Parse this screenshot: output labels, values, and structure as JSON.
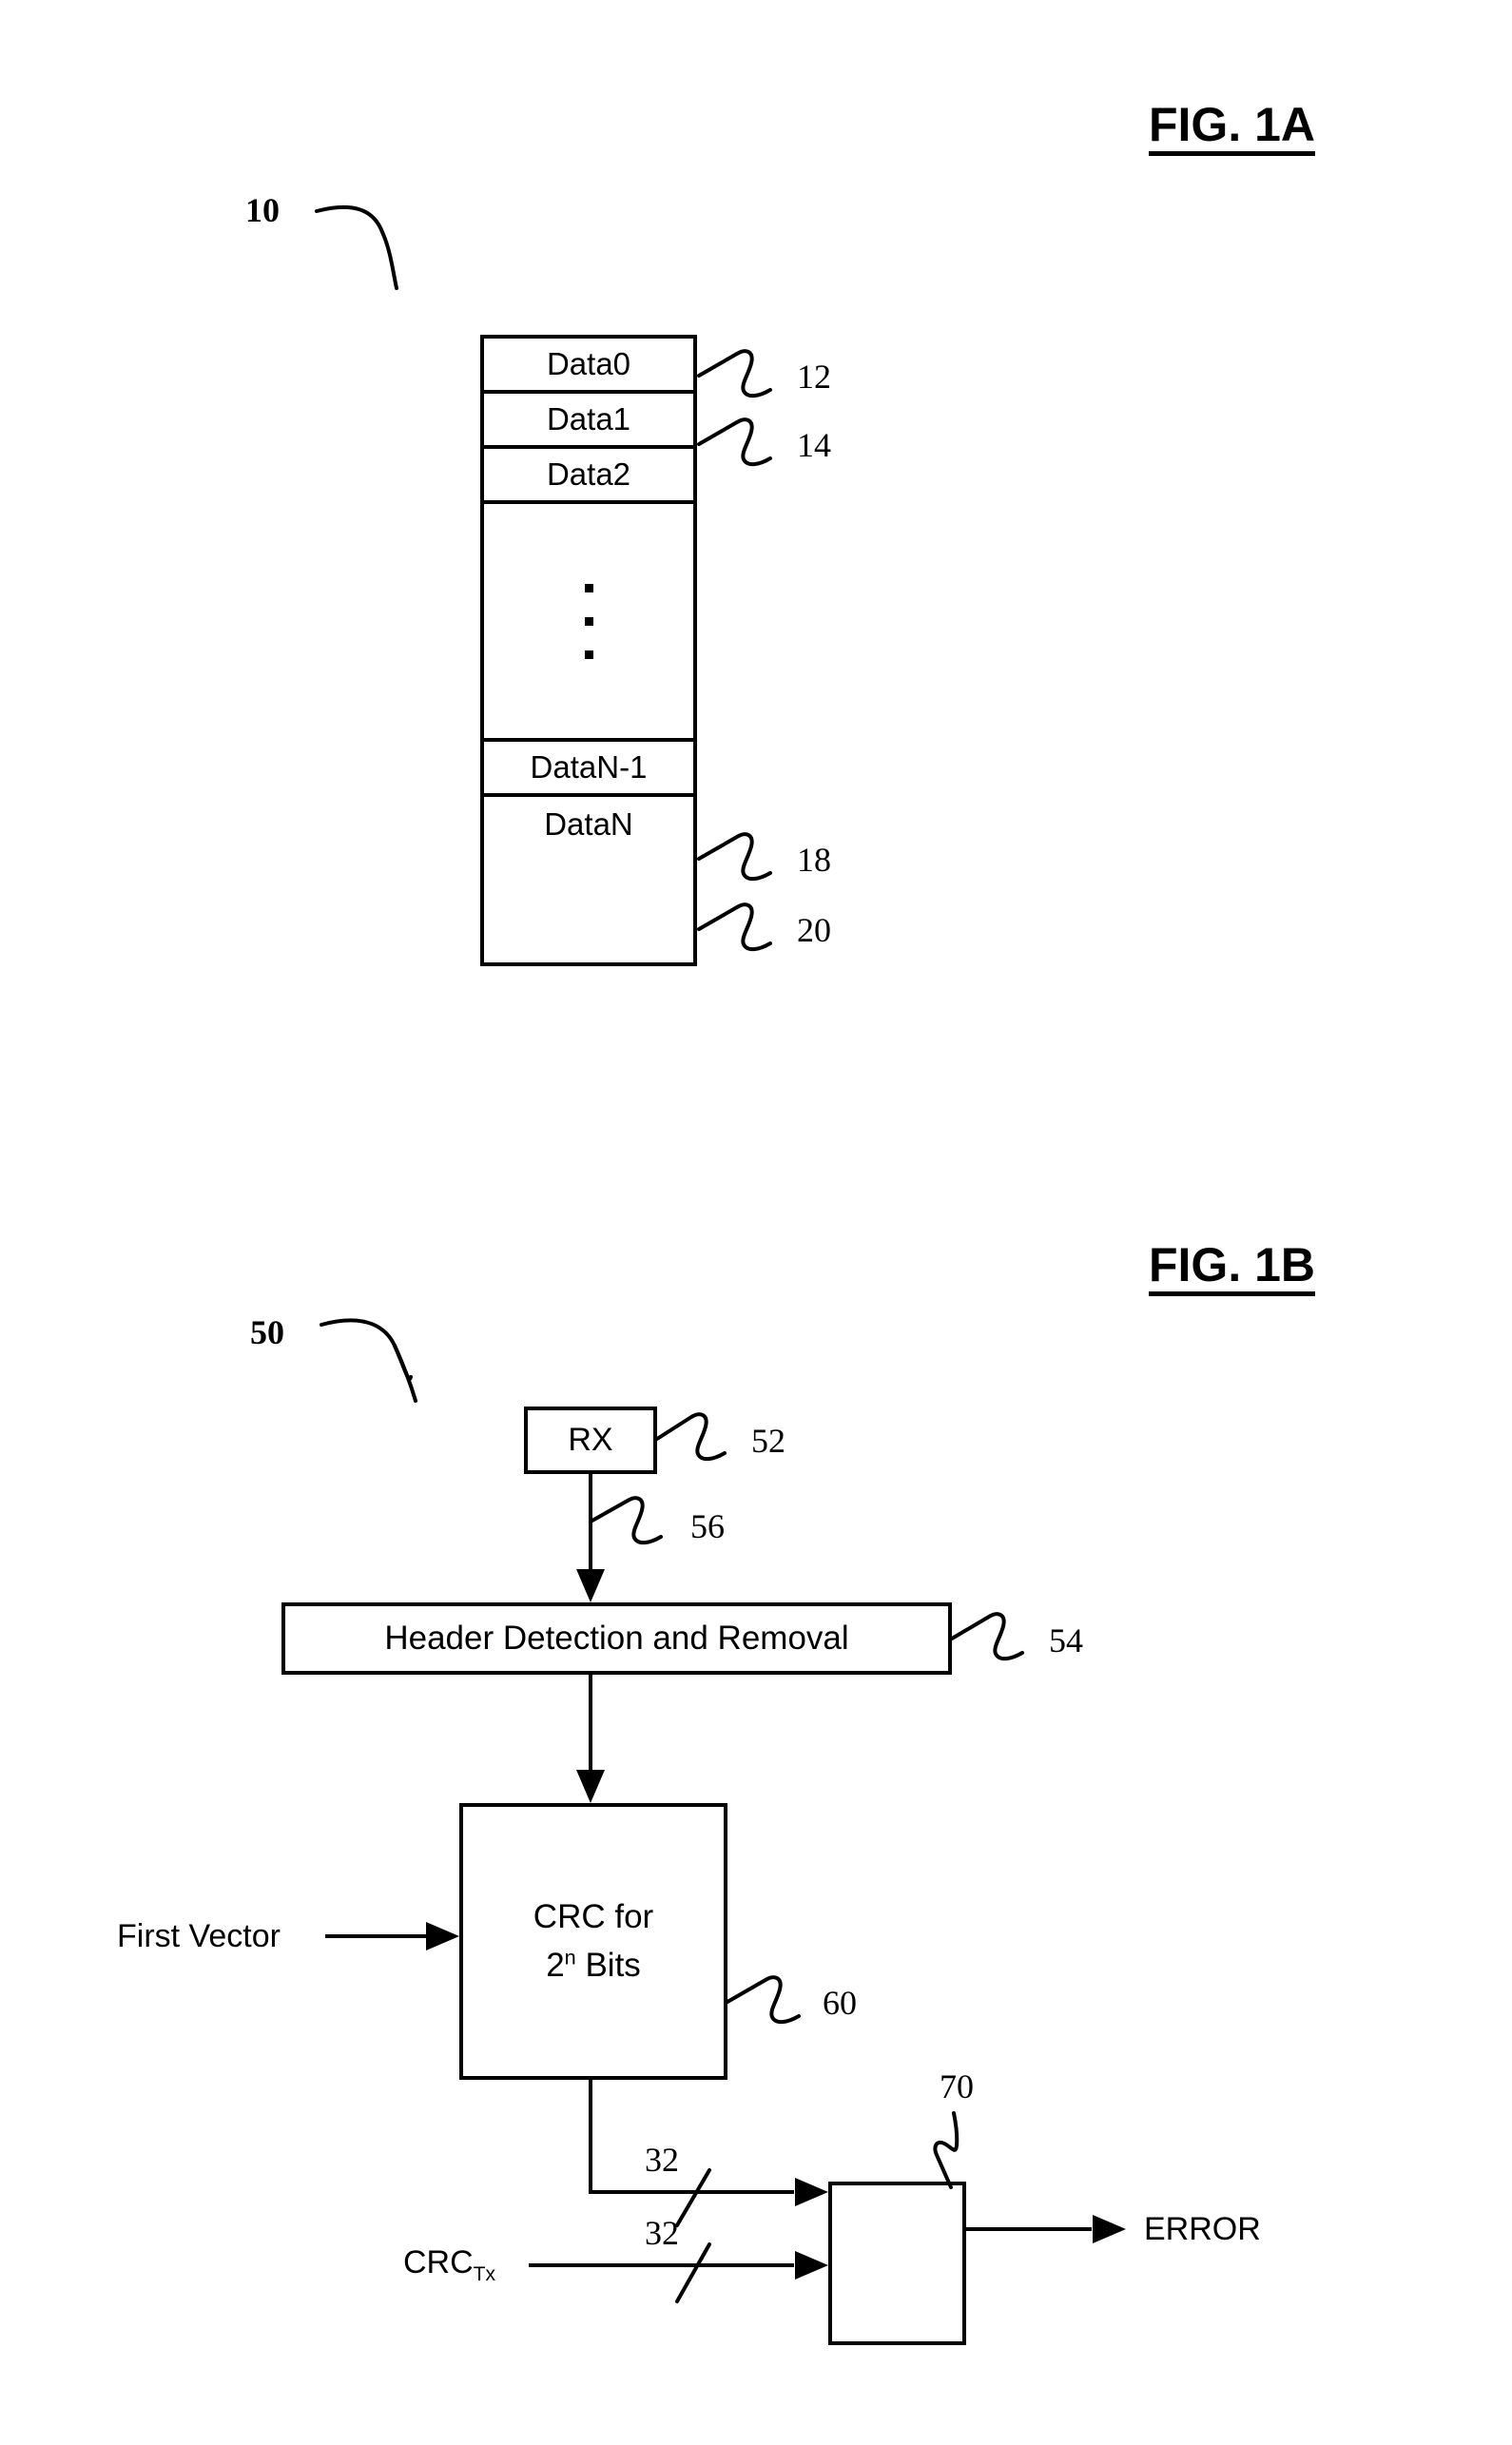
{
  "figures": [
    {
      "title": "FIG. 1A",
      "ref_label": "10",
      "data_block": {
        "cells": [
          {
            "label": "Data0",
            "ref": "12"
          },
          {
            "label": "Data1",
            "ref": "14"
          },
          {
            "label": "Data2",
            "ref": ""
          },
          {
            "label": "",
            "ref": ""
          },
          {
            "label": "DataN-1",
            "ref": "18"
          },
          {
            "label": "DataN",
            "ref": "20"
          }
        ],
        "ellipsis": "vertical-dots"
      }
    },
    {
      "title": "FIG. 1B",
      "ref_label": "50",
      "blocks": [
        {
          "name": "rx",
          "label": "RX",
          "ref": "52"
        },
        {
          "name": "header",
          "label": "Header Detection and Removal",
          "ref": "54"
        },
        {
          "name": "crc",
          "label_line1": "CRC for",
          "label_line2_base": "2",
          "label_line2_sup": "n",
          "label_line2_tail": " Bits",
          "ref": "60"
        },
        {
          "name": "comparator",
          "label": "",
          "ref": "70"
        }
      ],
      "connections": [
        {
          "name": "rx-to-header",
          "ref": "56"
        }
      ],
      "io_labels": {
        "first_vector": "First Vector",
        "crc_tx_base": "CRC",
        "crc_tx_sub": "Tx",
        "error_out": "ERROR"
      },
      "bus_widths": [
        {
          "name": "crc-out-bus",
          "value": "32"
        },
        {
          "name": "crc-tx-bus",
          "value": "32"
        }
      ]
    }
  ]
}
